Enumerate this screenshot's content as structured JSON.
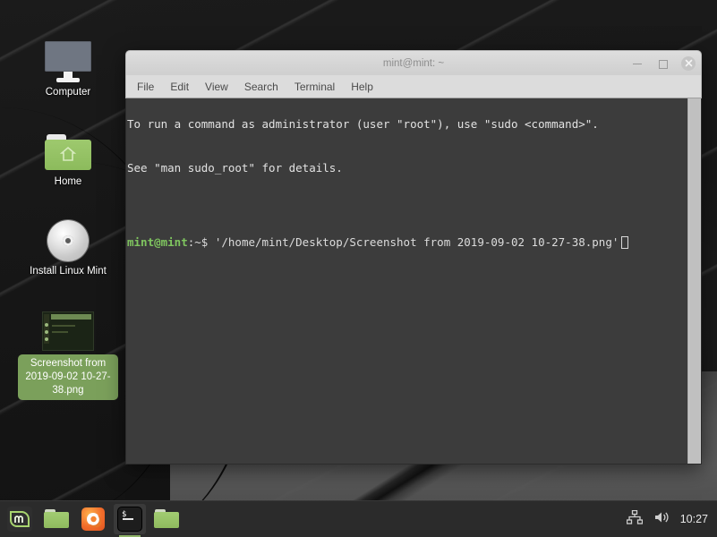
{
  "desktop": {
    "icons": [
      {
        "name": "computer",
        "label": "Computer",
        "icon": "monitor-icon",
        "selected": false
      },
      {
        "name": "home",
        "label": "Home",
        "icon": "folder-home-icon",
        "selected": false
      },
      {
        "name": "install-linux-mint",
        "label": "Install Linux Mint",
        "icon": "cd-disc-icon",
        "selected": false
      },
      {
        "name": "screenshot-file",
        "label": "Screenshot from 2019-09-02 10-27-38.png",
        "icon": "image-thumbnail-icon",
        "selected": true
      }
    ]
  },
  "terminal": {
    "title": "mint@mint: ~",
    "menu": [
      "File",
      "Edit",
      "View",
      "Search",
      "Terminal",
      "Help"
    ],
    "window_buttons": {
      "minimize": "minimize-icon",
      "maximize": "maximize-icon",
      "close": "close-icon"
    },
    "output": {
      "line1": "To run a command as administrator (user \"root\"), use \"sudo <command>\".",
      "line2": "See \"man sudo_root\" for details."
    },
    "prompt": {
      "user_host": "mint@mint",
      "path_symbol": ":~$",
      "command": " '/home/mint/Desktop/Screenshot from 2019-09-02 10-27-38.png'"
    },
    "colors": {
      "background": "#3c3c3c",
      "foreground": "#e2e2e2",
      "prompt_green": "#7fc55f",
      "titlebar": "#d6d6d6"
    }
  },
  "taskbar": {
    "items": [
      {
        "name": "mint-menu-button",
        "icon": "mint-logo-icon",
        "active": false
      },
      {
        "name": "file-manager-launcher",
        "icon": "folder-icon",
        "active": false
      },
      {
        "name": "firefox-launcher",
        "icon": "firefox-icon",
        "active": false
      },
      {
        "name": "terminal-window-button",
        "icon": "terminal-icon",
        "active": true
      },
      {
        "name": "files-window-button",
        "icon": "folder-icon",
        "active": false
      }
    ],
    "tray": {
      "network": "network-icon",
      "volume": "volume-icon",
      "clock": "10:27"
    }
  }
}
